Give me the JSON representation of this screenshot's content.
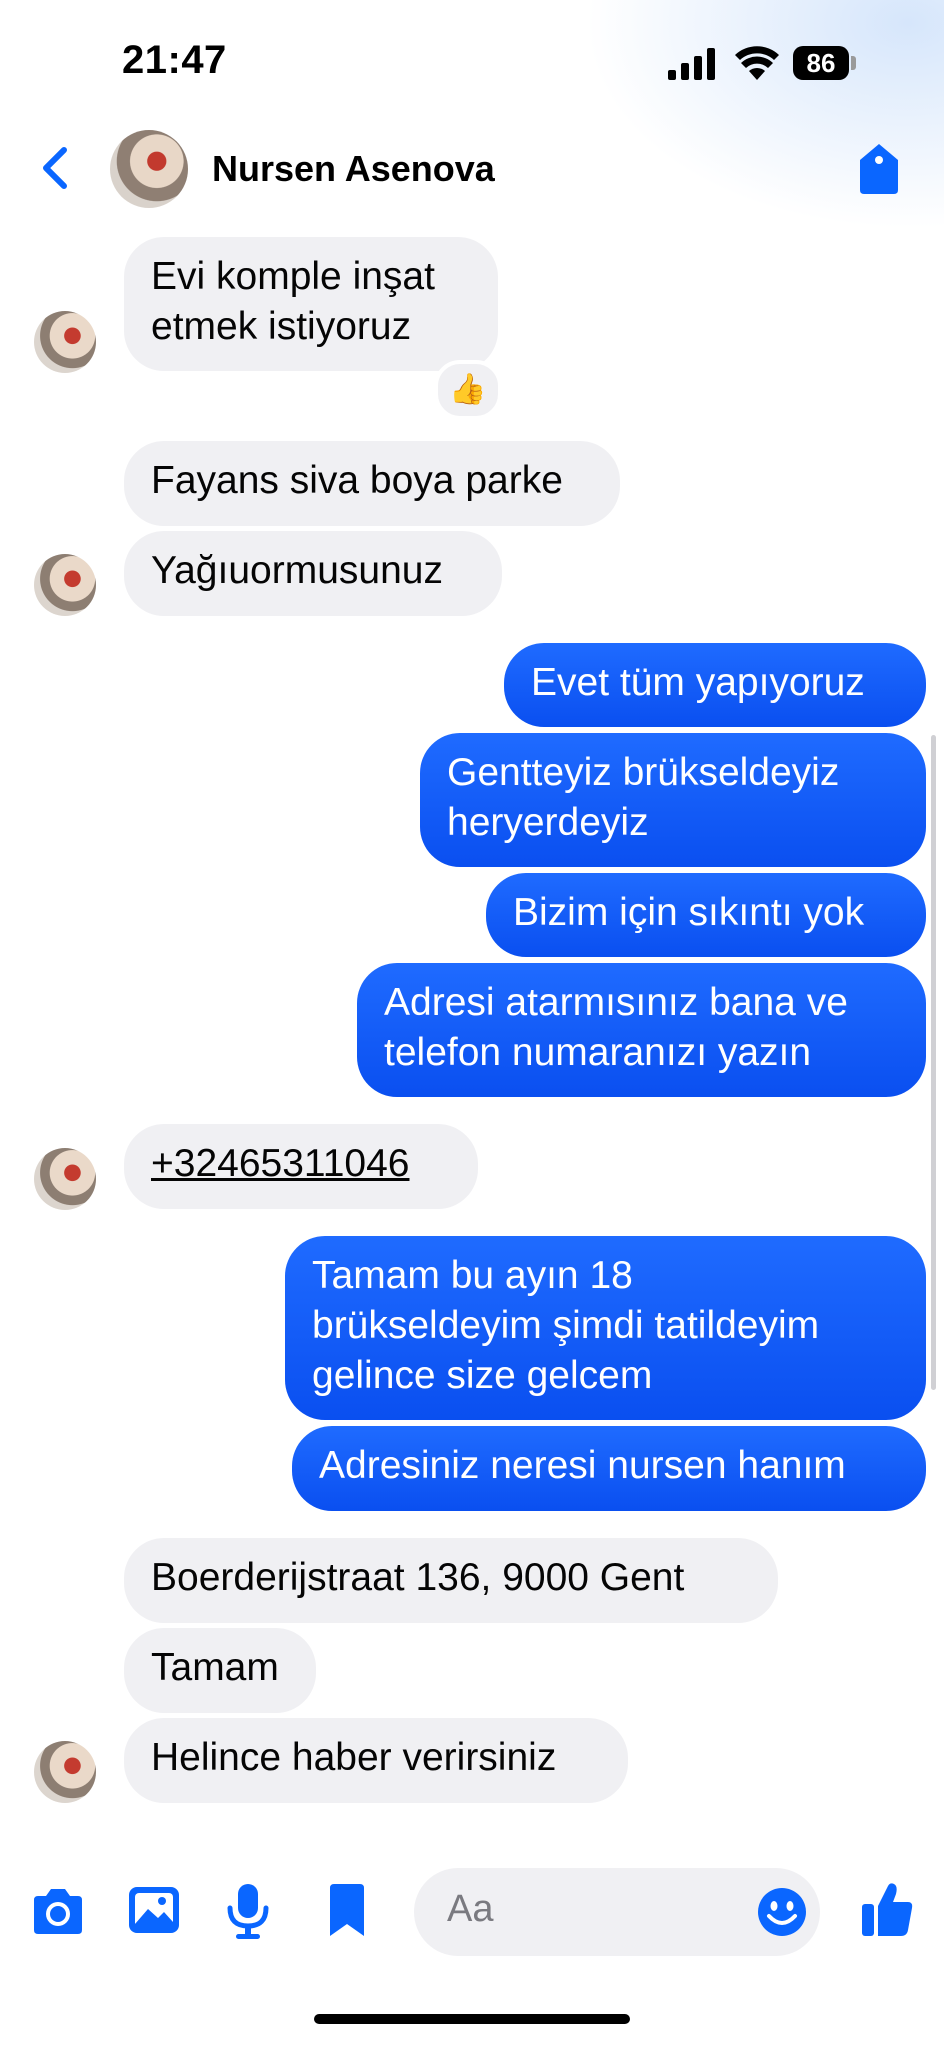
{
  "status_bar": {
    "time": "21:47",
    "battery": "86"
  },
  "header": {
    "contact_name": "Nursen Asenova"
  },
  "messages": [
    {
      "from": "them",
      "lines": [
        "Evi komple inşat",
        "etmek istiyoruz"
      ],
      "reaction": "👍"
    },
    {
      "from": "them",
      "lines": [
        "Fayans siva boya parke"
      ]
    },
    {
      "from": "them",
      "lines": [
        "Yağıuormusunuz"
      ]
    },
    {
      "from": "me",
      "lines": [
        "Evet tüm yapıyoruz"
      ]
    },
    {
      "from": "me",
      "lines": [
        "Gentteyiz brükseldeyiz",
        "heryerdeyiz"
      ]
    },
    {
      "from": "me",
      "lines": [
        "Bizim için sıkıntı yok"
      ]
    },
    {
      "from": "me",
      "lines": [
        "Adresi atarmısınız bana ve",
        "telefon numaranızı yazın"
      ]
    },
    {
      "from": "them",
      "lines": [
        "+32465311046"
      ],
      "link": true
    },
    {
      "from": "me",
      "lines": [
        "Tamam bu ayın 18",
        "brükseldeyim şimdi tatildeyim",
        "gelince size gelcem"
      ]
    },
    {
      "from": "me",
      "lines": [
        "Adresiniz neresi nursen hanım"
      ]
    },
    {
      "from": "them",
      "lines": [
        "Boerderijstraat 136, 9000 Gent"
      ]
    },
    {
      "from": "them",
      "lines": [
        "Tamam"
      ]
    },
    {
      "from": "them",
      "lines": [
        "Helince haber verirsiniz"
      ]
    }
  ],
  "composer": {
    "placeholder": "Aa"
  },
  "icons": {
    "back": "chevron-left-icon",
    "camera": "camera-icon",
    "gallery": "image-icon",
    "mic": "microphone-icon",
    "sticker": "bookmark-icon",
    "emoji": "smiley-icon",
    "like": "thumbs-up-icon",
    "header_action": "tag-icon"
  },
  "colors": {
    "accent": "#0a5cff",
    "incoming": "#f0f0f3",
    "outgoing_top": "#1f6bff",
    "outgoing_bottom": "#0a4ff0"
  }
}
